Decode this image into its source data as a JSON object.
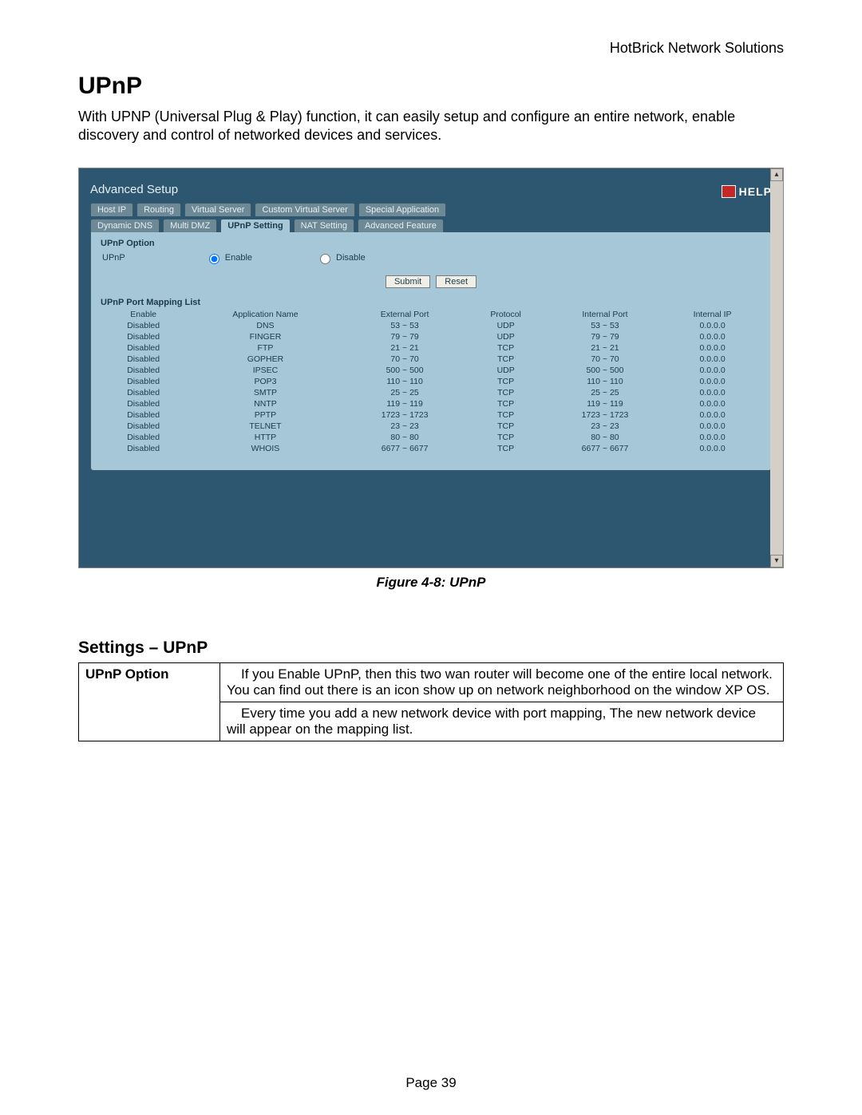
{
  "brand": "HotBrick Network Solutions",
  "title": "UPnP",
  "intro": "With UPNP (Universal Plug & Play) function, it can easily setup and configure an entire network, enable discovery and control of networked devices and services.",
  "screenshot": {
    "panel_title": "Advanced Setup",
    "help_label": "HELP",
    "tabs_row1": [
      "Host IP",
      "Routing",
      "Virtual Server",
      "Custom Virtual Server",
      "Special Application"
    ],
    "tabs_row2": [
      "Dynamic DNS",
      "Multi DMZ",
      "UPnP Setting",
      "NAT Setting",
      "Advanced Feature"
    ],
    "active_tab": "UPnP Setting",
    "option_heading": "UPnP Option",
    "option_label": "UPnP",
    "enable_label": "Enable",
    "disable_label": "Disable",
    "submit_label": "Submit",
    "reset_label": "Reset",
    "list_heading": "UPnP Port Mapping List",
    "columns": [
      "Enable",
      "Application Name",
      "External Port",
      "Protocol",
      "Internal Port",
      "Internal IP"
    ],
    "rows": [
      {
        "c": [
          "Disabled",
          "DNS",
          "53 ~ 53",
          "UDP",
          "53 ~ 53",
          "0.0.0.0"
        ]
      },
      {
        "c": [
          "Disabled",
          "FINGER",
          "79 ~ 79",
          "UDP",
          "79 ~ 79",
          "0.0.0.0"
        ]
      },
      {
        "c": [
          "Disabled",
          "FTP",
          "21 ~ 21",
          "TCP",
          "21 ~ 21",
          "0.0.0.0"
        ]
      },
      {
        "c": [
          "Disabled",
          "GOPHER",
          "70 ~ 70",
          "TCP",
          "70 ~ 70",
          "0.0.0.0"
        ]
      },
      {
        "c": [
          "Disabled",
          "IPSEC",
          "500 ~ 500",
          "UDP",
          "500 ~ 500",
          "0.0.0.0"
        ]
      },
      {
        "c": [
          "Disabled",
          "POP3",
          "110 ~ 110",
          "TCP",
          "110 ~ 110",
          "0.0.0.0"
        ]
      },
      {
        "c": [
          "Disabled",
          "SMTP",
          "25 ~ 25",
          "TCP",
          "25 ~ 25",
          "0.0.0.0"
        ]
      },
      {
        "c": [
          "Disabled",
          "NNTP",
          "119 ~ 119",
          "TCP",
          "119 ~ 119",
          "0.0.0.0"
        ]
      },
      {
        "c": [
          "Disabled",
          "PPTP",
          "1723 ~ 1723",
          "TCP",
          "1723 ~ 1723",
          "0.0.0.0"
        ]
      },
      {
        "c": [
          "Disabled",
          "TELNET",
          "23 ~ 23",
          "TCP",
          "23 ~ 23",
          "0.0.0.0"
        ]
      },
      {
        "c": [
          "Disabled",
          "HTTP",
          "80 ~ 80",
          "TCP",
          "80 ~ 80",
          "0.0.0.0"
        ]
      },
      {
        "c": [
          "Disabled",
          "WHOIS",
          "6677 ~ 6677",
          "TCP",
          "6677 ~ 6677",
          "0.0.0.0"
        ]
      }
    ]
  },
  "figure_caption": "Figure 4-8: UPnP",
  "settings_heading": "Settings – UPnP",
  "settings_table": {
    "label": "UPnP Option",
    "cell1": "If you Enable UPnP, then this two wan router will become one of the entire local network. You can find out there is an icon show up on network neighborhood on the window XP OS.",
    "cell2": "Every time you add a new network device with port mapping, The new network device will appear on the mapping list."
  },
  "page_number": "Page 39"
}
